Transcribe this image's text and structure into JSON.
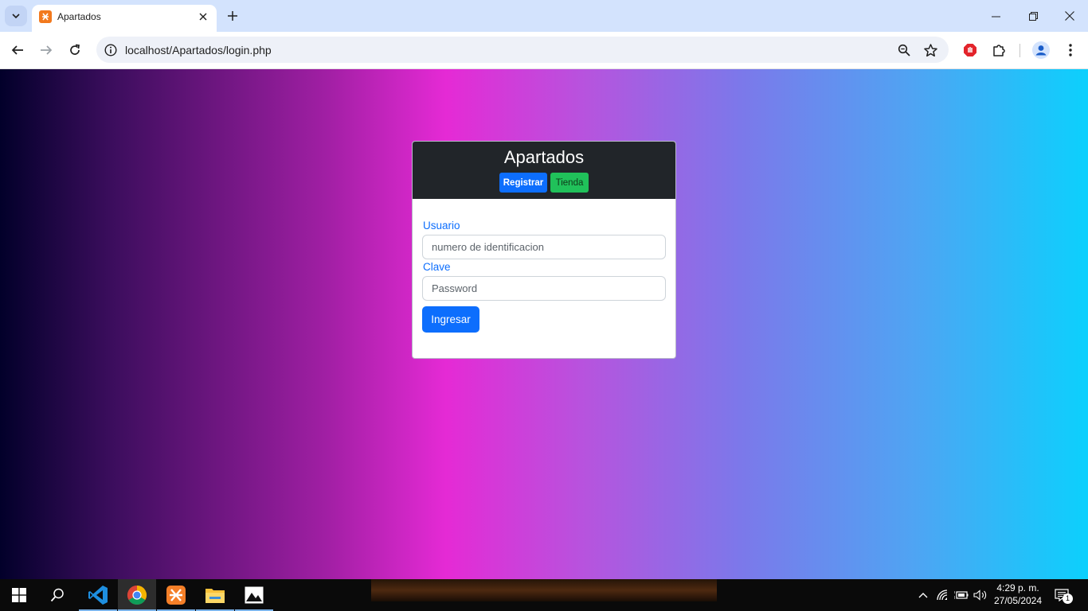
{
  "browser": {
    "tab_title": "Apartados",
    "url": "localhost/Apartados/login.php"
  },
  "page": {
    "card_title": "Apartados",
    "registrar_label": "Registrar",
    "tienda_label": "Tienda",
    "usuario_label": "Usuario",
    "usuario_placeholder": "numero de identificacion",
    "clave_label": "Clave",
    "clave_placeholder": "Password",
    "ingresar_label": "Ingresar"
  },
  "taskbar": {
    "time": "4:29 p. m.",
    "date": "27/05/2024",
    "notification_count": "1"
  },
  "colors": {
    "primary": "#0d6efd",
    "success": "#20c15a",
    "header_dark": "#212529"
  }
}
